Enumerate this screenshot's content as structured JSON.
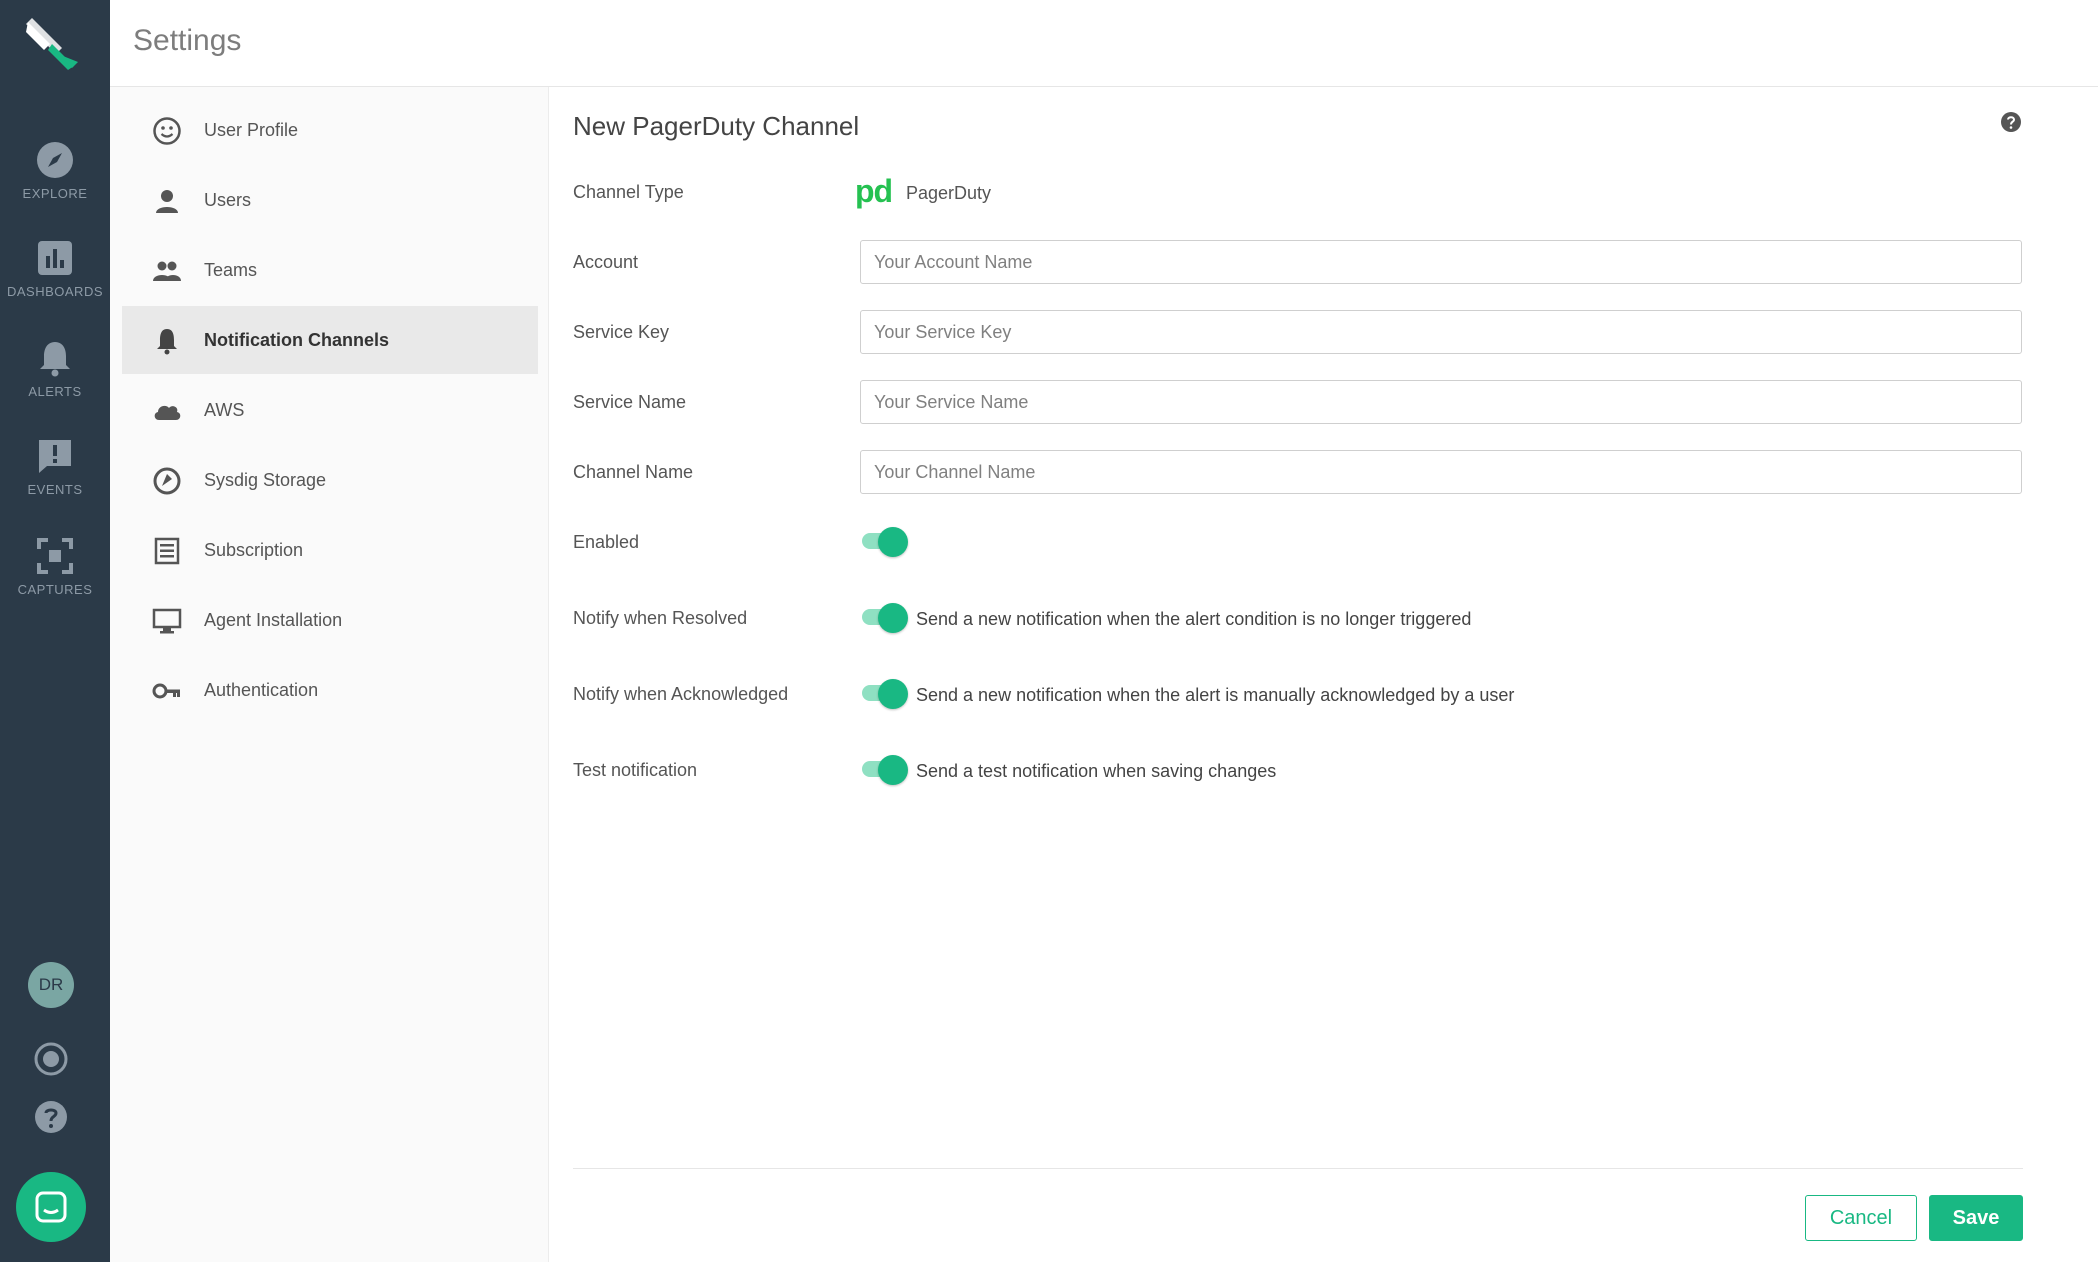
{
  "app": {
    "nav": [
      {
        "label": "EXPLORE",
        "icon": "compass-icon"
      },
      {
        "label": "DASHBOARDS",
        "icon": "bar-chart-icon"
      },
      {
        "label": "ALERTS",
        "icon": "bell-icon"
      },
      {
        "label": "EVENTS",
        "icon": "message-alert-icon"
      },
      {
        "label": "CAPTURES",
        "icon": "capture-icon"
      }
    ],
    "avatar_initials": "DR",
    "accent_color": "#19b883",
    "rail_color": "#2b3a48"
  },
  "header": {
    "title": "Settings"
  },
  "menu": {
    "items": [
      {
        "label": "User Profile",
        "icon": "smiley-icon"
      },
      {
        "label": "Users",
        "icon": "user-icon"
      },
      {
        "label": "Teams",
        "icon": "group-icon"
      },
      {
        "label": "Notification Channels",
        "icon": "bell-icon",
        "active": true
      },
      {
        "label": "AWS",
        "icon": "cloud-icon"
      },
      {
        "label": "Sysdig Storage",
        "icon": "storage-icon"
      },
      {
        "label": "Subscription",
        "icon": "list-icon"
      },
      {
        "label": "Agent Installation",
        "icon": "monitor-icon"
      },
      {
        "label": "Authentication",
        "icon": "key-icon"
      }
    ]
  },
  "form": {
    "title": "New PagerDuty Channel",
    "channel_type_label": "Channel Type",
    "channel_type_logo": "pd",
    "channel_type_value": "PagerDuty",
    "account_label": "Account",
    "account_placeholder": "Your Account Name",
    "service_key_label": "Service Key",
    "service_key_placeholder": "Your Service Key",
    "service_name_label": "Service Name",
    "service_name_placeholder": "Your Service Name",
    "channel_name_label": "Channel Name",
    "channel_name_placeholder": "Your Channel Name",
    "enabled_label": "Enabled",
    "enabled": true,
    "resolved_label": "Notify when Resolved",
    "resolved_desc": "Send a new notification when the alert condition is no longer triggered",
    "resolved": true,
    "acknowledged_label": "Notify when Acknowledged",
    "acknowledged_desc": "Send a new notification when the alert is manually acknowledged by a user",
    "acknowledged": true,
    "test_label": "Test notification",
    "test_desc": "Send a test notification when saving changes",
    "test": true,
    "cancel_label": "Cancel",
    "save_label": "Save"
  }
}
